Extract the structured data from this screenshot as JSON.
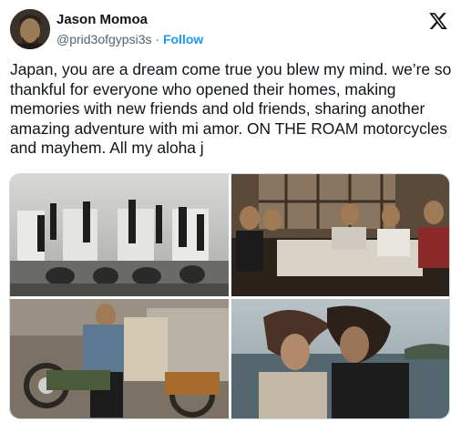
{
  "author": {
    "name": "Jason Momoa",
    "handle": "@prid3ofgypsi3s",
    "separator": " · ",
    "follow_label": "Follow",
    "avatar_icon": "avatar-photo"
  },
  "platform": {
    "logo_icon": "x-logo-icon"
  },
  "tweet": {
    "text": "Japan, you are a dream come true you blew my mind. we’re so thankful for everyone who opened their homes, making memories with new friends and old friends, sharing another amazing adventure with mi amor. ON THE ROAM motorcycles and mayhem. All my aloha j"
  },
  "media": {
    "count": 4,
    "photos": [
      {
        "description_icon": "photo-riders-on-japan-sign"
      },
      {
        "description_icon": "photo-dinner-table-group"
      },
      {
        "description_icon": "photo-motorcycle-garage"
      },
      {
        "description_icon": "photo-windy-seaside-selfie"
      }
    ]
  },
  "colors": {
    "text": "#0f1419",
    "secondary": "#536471",
    "accent": "#1d9bf0",
    "border": "#cfd9de"
  }
}
